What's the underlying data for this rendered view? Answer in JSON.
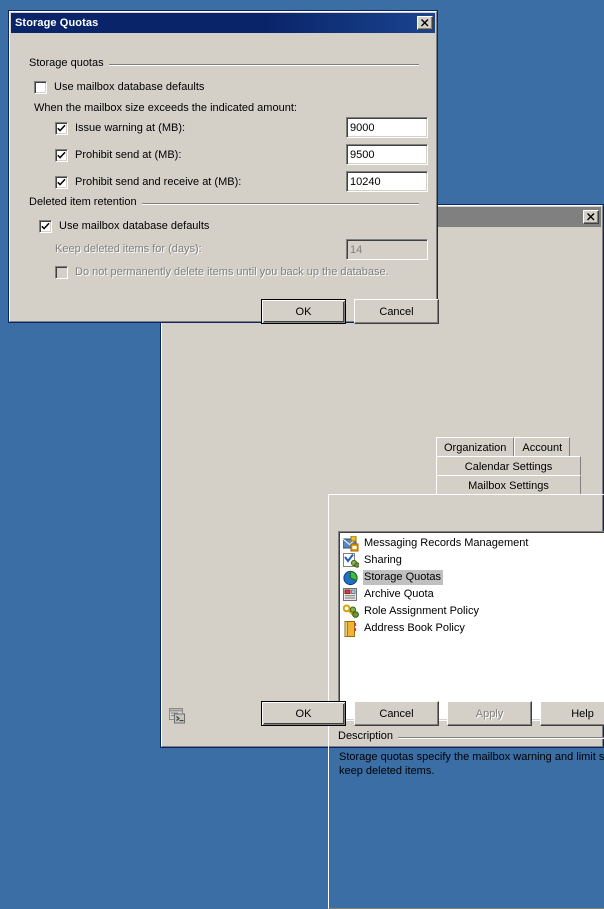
{
  "desktop": {
    "background_color": "#3a6ea5"
  },
  "properties_window": {
    "title": "",
    "close_label": "close-icon",
    "tab_rows": [
      [
        {
          "label": "Organization"
        },
        {
          "label": "Account"
        }
      ],
      [
        {
          "label": "Calendar Settings"
        }
      ],
      [
        {
          "label": "Mailbox Settings"
        }
      ]
    ],
    "list": {
      "items": [
        {
          "label": "Messaging Records Management",
          "icon": "messaging-records-icon",
          "selected": false
        },
        {
          "label": "Sharing",
          "icon": "sharing-icon",
          "selected": false
        },
        {
          "label": "Storage Quotas",
          "icon": "storage-quotas-icon",
          "selected": true
        },
        {
          "label": "Archive Quota",
          "icon": "archive-quota-icon",
          "selected": false
        },
        {
          "label": "Role Assignment Policy",
          "icon": "role-assignment-policy-icon",
          "selected": false
        },
        {
          "label": "Address Book Policy",
          "icon": "address-book-policy-icon",
          "selected": false
        }
      ]
    },
    "description": {
      "group_title": "Description",
      "text": "Storage quotas specify the mailbox warning and limit sizes and how long to keep deleted items."
    },
    "footer": {
      "shell_icon": "powershell-command-log-icon",
      "buttons": [
        {
          "label": "OK",
          "default": true,
          "disabled": false
        },
        {
          "label": "Cancel",
          "default": false,
          "disabled": false
        },
        {
          "label": "Apply",
          "default": false,
          "disabled": true
        },
        {
          "label": "Help",
          "default": false,
          "disabled": false
        }
      ]
    }
  },
  "storage_quotas_dialog": {
    "title": "Storage Quotas",
    "close_label": "close-icon",
    "storage_quotas_group": {
      "title": "Storage quotas",
      "use_defaults": {
        "label": "Use mailbox database defaults",
        "checked": false
      },
      "hint": "When the mailbox size exceeds the indicated amount:",
      "rows": [
        {
          "label": "Issue warning at (MB):",
          "checked": true,
          "value": "9000"
        },
        {
          "label": "Prohibit send at (MB):",
          "checked": true,
          "value": "9500"
        },
        {
          "label": "Prohibit send and receive at (MB):",
          "checked": true,
          "value": "10240"
        }
      ]
    },
    "deleted_item_retention_group": {
      "title": "Deleted item retention",
      "use_defaults": {
        "label": "Use mailbox database defaults",
        "checked": true
      },
      "keep_days": {
        "label": "Keep deleted items for (days):",
        "value": "14",
        "disabled": true
      },
      "no_permanent_delete": {
        "label": "Do not permanently delete items until you back up the database.",
        "checked": false,
        "disabled": true
      }
    },
    "buttons": [
      {
        "label": "OK",
        "default": true
      },
      {
        "label": "Cancel",
        "default": false
      }
    ]
  }
}
